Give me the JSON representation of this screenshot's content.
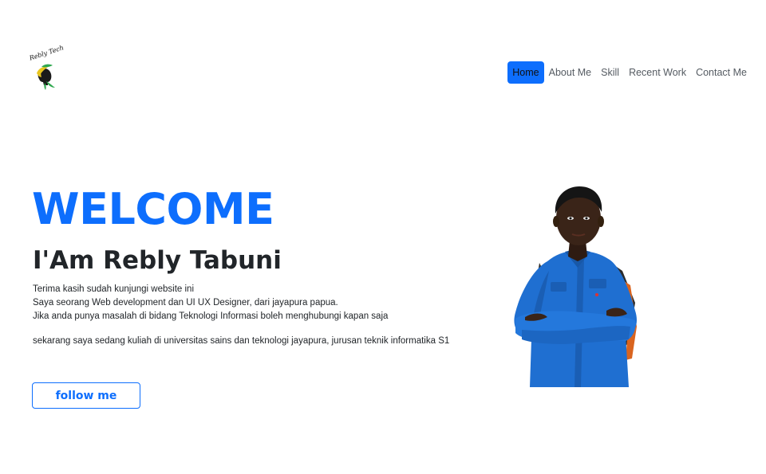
{
  "logo": {
    "text": "Rebly Tech",
    "icon": "logo-icon"
  },
  "nav": {
    "items": [
      {
        "label": "Home",
        "active": true
      },
      {
        "label": "About Me",
        "active": false
      },
      {
        "label": "Skill",
        "active": false
      },
      {
        "label": "Recent Work",
        "active": false
      },
      {
        "label": "Contact Me",
        "active": false
      }
    ]
  },
  "hero": {
    "welcome": "WELCOME",
    "name": "I'Am Rebly Tabuni",
    "lines": [
      "Terima kasih sudah kunjungi website ini",
      "Saya seorang Web development dan UI UX Designer, dari jayapura papua.",
      "Jika anda punya masalah di bidang Teknologi Informasi boleh menghubungi kapan saja"
    ],
    "extra": "sekarang saya sedang kuliah di universitas sains dan teknologi jayapura, jurusan teknik informatika S1",
    "button": "follow me",
    "photo": "profile-photo"
  },
  "colors": {
    "primary": "#0d6efd",
    "text": "#212529",
    "nav_text": "#555b62"
  }
}
